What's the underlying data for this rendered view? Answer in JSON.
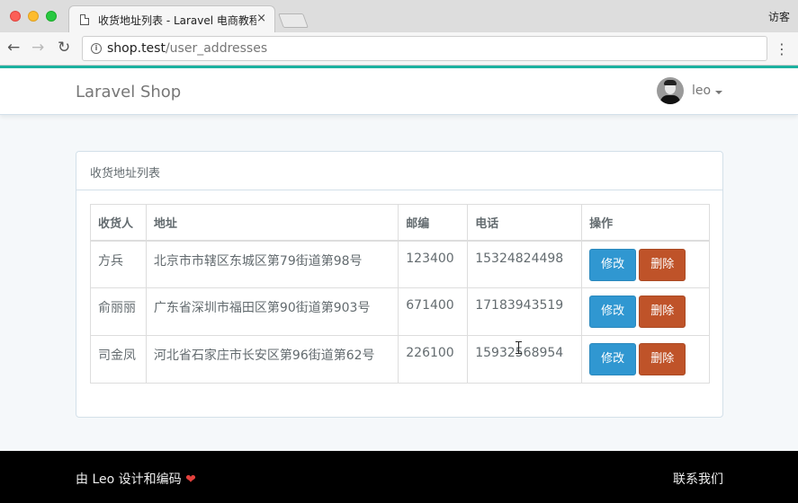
{
  "browser": {
    "tab_title": "收货地址列表 - Laravel 电商教程",
    "tab_close": "×",
    "guest_label": "访客",
    "url_host": "shop.test",
    "url_path": "/user_addresses"
  },
  "navbar": {
    "brand": "Laravel Shop",
    "username": "leo"
  },
  "panel": {
    "title": "收货地址列表",
    "columns": [
      "收货人",
      "地址",
      "邮编",
      "电话",
      "操作"
    ],
    "rows": [
      {
        "name": "方兵",
        "address": "北京市市辖区东城区第79街道第98号",
        "zip": "123400",
        "phone": "15324824498"
      },
      {
        "name": "俞丽丽",
        "address": "广东省深圳市福田区第90街道第903号",
        "zip": "671400",
        "phone": "17183943519"
      },
      {
        "name": "司金凤",
        "address": "河北省石家庄市长安区第96街道第62号",
        "zip": "226100",
        "phone": "15932568954"
      }
    ],
    "edit_label": "修改",
    "delete_label": "删除"
  },
  "footer": {
    "credit": "由 Leo 设计和编码",
    "heart": "❤",
    "contact": "联系我们"
  },
  "colors": {
    "accent": "#1cb1a0",
    "primary": "#3097d1",
    "danger": "#bf5329"
  }
}
